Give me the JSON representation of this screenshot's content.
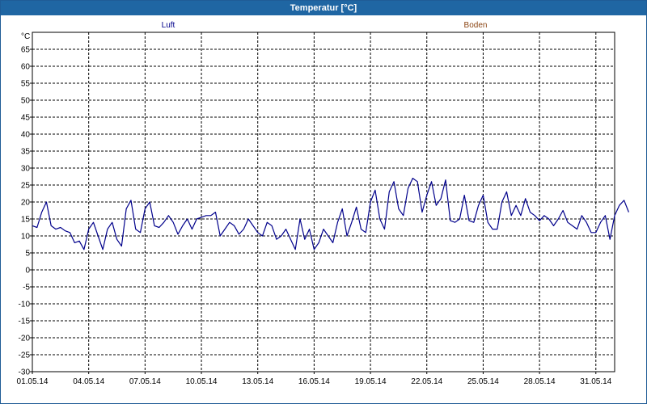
{
  "window": {
    "title": "Temperatur [°C]"
  },
  "legend": [
    {
      "label": "Luft",
      "color": "#00008b"
    },
    {
      "label": "Boden",
      "color": "#8b4513"
    }
  ],
  "chart_data": {
    "type": "line",
    "title": "Temperatur [°C]",
    "ylabel": "°C",
    "xlabel": "",
    "ylim": [
      -30,
      70
    ],
    "yticks": [
      -30,
      -25,
      -20,
      -15,
      -10,
      -5,
      0,
      5,
      10,
      15,
      20,
      25,
      30,
      35,
      40,
      45,
      50,
      55,
      60,
      65
    ],
    "xlim": [
      "01.05.14",
      "01.06.14"
    ],
    "xticks": [
      "01.05.14",
      "04.05.14",
      "07.05.14",
      "10.05.14",
      "13.05.14",
      "16.05.14",
      "19.05.14",
      "22.05.14",
      "25.05.14",
      "28.05.14",
      "31.05.14"
    ],
    "grid": true,
    "series": [
      {
        "name": "Luft",
        "color": "#00008b",
        "points": [
          [
            "01.05.14 00:00",
            13
          ],
          [
            "01.05.14 06:00",
            12.5
          ],
          [
            "01.05.14 12:00",
            17
          ],
          [
            "01.05.14 18:00",
            20
          ],
          [
            "02.05.14 00:00",
            13
          ],
          [
            "02.05.14 06:00",
            12
          ],
          [
            "02.05.14 12:00",
            12.5
          ],
          [
            "02.05.14 18:00",
            11.5
          ],
          [
            "03.05.14 00:00",
            11
          ],
          [
            "03.05.14 06:00",
            8
          ],
          [
            "03.05.14 12:00",
            8.5
          ],
          [
            "03.05.14 18:00",
            6
          ],
          [
            "04.05.14 00:00",
            12
          ],
          [
            "04.05.14 06:00",
            14
          ],
          [
            "04.05.14 12:00",
            10
          ],
          [
            "04.05.14 18:00",
            6
          ],
          [
            "05.05.14 00:00",
            12
          ],
          [
            "05.05.14 06:00",
            14
          ],
          [
            "05.05.14 12:00",
            9
          ],
          [
            "05.05.14 18:00",
            7
          ],
          [
            "06.05.14 00:00",
            18
          ],
          [
            "06.05.14 06:00",
            20.5
          ],
          [
            "06.05.14 12:00",
            12
          ],
          [
            "06.05.14 18:00",
            11
          ],
          [
            "07.05.14 00:00",
            18
          ],
          [
            "07.05.14 06:00",
            20
          ],
          [
            "07.05.14 12:00",
            13
          ],
          [
            "07.05.14 18:00",
            12.5
          ],
          [
            "08.05.14 00:00",
            14
          ],
          [
            "08.05.14 06:00",
            16
          ],
          [
            "08.05.14 12:00",
            14
          ],
          [
            "08.05.14 18:00",
            10.5
          ],
          [
            "09.05.14 00:00",
            13
          ],
          [
            "09.05.14 06:00",
            15
          ],
          [
            "09.05.14 12:00",
            12
          ],
          [
            "09.05.14 18:00",
            15
          ],
          [
            "10.05.14 00:00",
            15.5
          ],
          [
            "10.05.14 06:00",
            16
          ],
          [
            "10.05.14 12:00",
            16
          ],
          [
            "10.05.14 18:00",
            17
          ],
          [
            "11.05.14 00:00",
            10
          ],
          [
            "11.05.14 06:00",
            12
          ],
          [
            "11.05.14 12:00",
            14
          ],
          [
            "11.05.14 18:00",
            13
          ],
          [
            "12.05.14 00:00",
            10.5
          ],
          [
            "12.05.14 06:00",
            12
          ],
          [
            "12.05.14 12:00",
            15
          ],
          [
            "12.05.14 18:00",
            13
          ],
          [
            "13.05.14 00:00",
            11
          ],
          [
            "13.05.14 06:00",
            10
          ],
          [
            "13.05.14 12:00",
            14
          ],
          [
            "13.05.14 18:00",
            13
          ],
          [
            "14.05.14 00:00",
            9
          ],
          [
            "14.05.14 06:00",
            10
          ],
          [
            "14.05.14 12:00",
            12
          ],
          [
            "14.05.14 18:00",
            9
          ],
          [
            "15.05.14 00:00",
            6
          ],
          [
            "15.05.14 06:00",
            15
          ],
          [
            "15.05.14 12:00",
            9
          ],
          [
            "15.05.14 18:00",
            12
          ],
          [
            "16.05.14 00:00",
            6
          ],
          [
            "16.05.14 06:00",
            8
          ],
          [
            "16.05.14 12:00",
            12
          ],
          [
            "16.05.14 18:00",
            10
          ],
          [
            "17.05.14 00:00",
            8
          ],
          [
            "17.05.14 06:00",
            14
          ],
          [
            "17.05.14 12:00",
            18
          ],
          [
            "17.05.14 18:00",
            10
          ],
          [
            "18.05.14 00:00",
            14
          ],
          [
            "18.05.14 06:00",
            18.5
          ],
          [
            "18.05.14 12:00",
            12
          ],
          [
            "18.05.14 18:00",
            11
          ],
          [
            "19.05.14 00:00",
            20
          ],
          [
            "19.05.14 06:00",
            23.5
          ],
          [
            "19.05.14 12:00",
            15
          ],
          [
            "19.05.14 18:00",
            12
          ],
          [
            "20.05.14 00:00",
            23
          ],
          [
            "20.05.14 06:00",
            26
          ],
          [
            "20.05.14 12:00",
            18
          ],
          [
            "20.05.14 18:00",
            16
          ],
          [
            "21.05.14 00:00",
            24
          ],
          [
            "21.05.14 06:00",
            27
          ],
          [
            "21.05.14 12:00",
            26
          ],
          [
            "21.05.14 18:00",
            17
          ],
          [
            "22.05.14 00:00",
            22
          ],
          [
            "22.05.14 06:00",
            26
          ],
          [
            "22.05.14 12:00",
            19
          ],
          [
            "22.05.14 18:00",
            21
          ],
          [
            "23.05.14 00:00",
            26.5
          ],
          [
            "23.05.14 06:00",
            14.5
          ],
          [
            "23.05.14 12:00",
            14
          ],
          [
            "23.05.14 18:00",
            15
          ],
          [
            "24.05.14 00:00",
            22
          ],
          [
            "24.05.14 06:00",
            14.5
          ],
          [
            "24.05.14 12:00",
            14
          ],
          [
            "24.05.14 18:00",
            19
          ],
          [
            "25.05.14 00:00",
            22
          ],
          [
            "25.05.14 06:00",
            14
          ],
          [
            "25.05.14 12:00",
            12
          ],
          [
            "25.05.14 18:00",
            12
          ],
          [
            "26.05.14 00:00",
            20
          ],
          [
            "26.05.14 06:00",
            23
          ],
          [
            "26.05.14 12:00",
            16
          ],
          [
            "26.05.14 18:00",
            19
          ],
          [
            "27.05.14 00:00",
            16
          ],
          [
            "27.05.14 06:00",
            21
          ],
          [
            "27.05.14 12:00",
            17
          ],
          [
            "27.05.14 18:00",
            16
          ],
          [
            "28.05.14 00:00",
            14.5
          ],
          [
            "28.05.14 06:00",
            16
          ],
          [
            "28.05.14 12:00",
            15
          ],
          [
            "28.05.14 18:00",
            13
          ],
          [
            "29.05.14 00:00",
            15
          ],
          [
            "29.05.14 06:00",
            17.5
          ],
          [
            "29.05.14 12:00",
            14
          ],
          [
            "29.05.14 18:00",
            13
          ],
          [
            "30.05.14 00:00",
            12
          ],
          [
            "30.05.14 06:00",
            16
          ],
          [
            "30.05.14 12:00",
            14
          ],
          [
            "30.05.14 18:00",
            11
          ],
          [
            "31.05.14 00:00",
            11
          ],
          [
            "31.05.14 06:00",
            14
          ],
          [
            "31.05.14 12:00",
            16
          ],
          [
            "31.05.14 18:00",
            9
          ],
          [
            "01.06.14 00:00",
            16
          ],
          [
            "01.06.14 06:00",
            19
          ],
          [
            "01.06.14 12:00",
            20.5
          ],
          [
            "01.06.14 18:00",
            17
          ]
        ]
      }
    ]
  }
}
